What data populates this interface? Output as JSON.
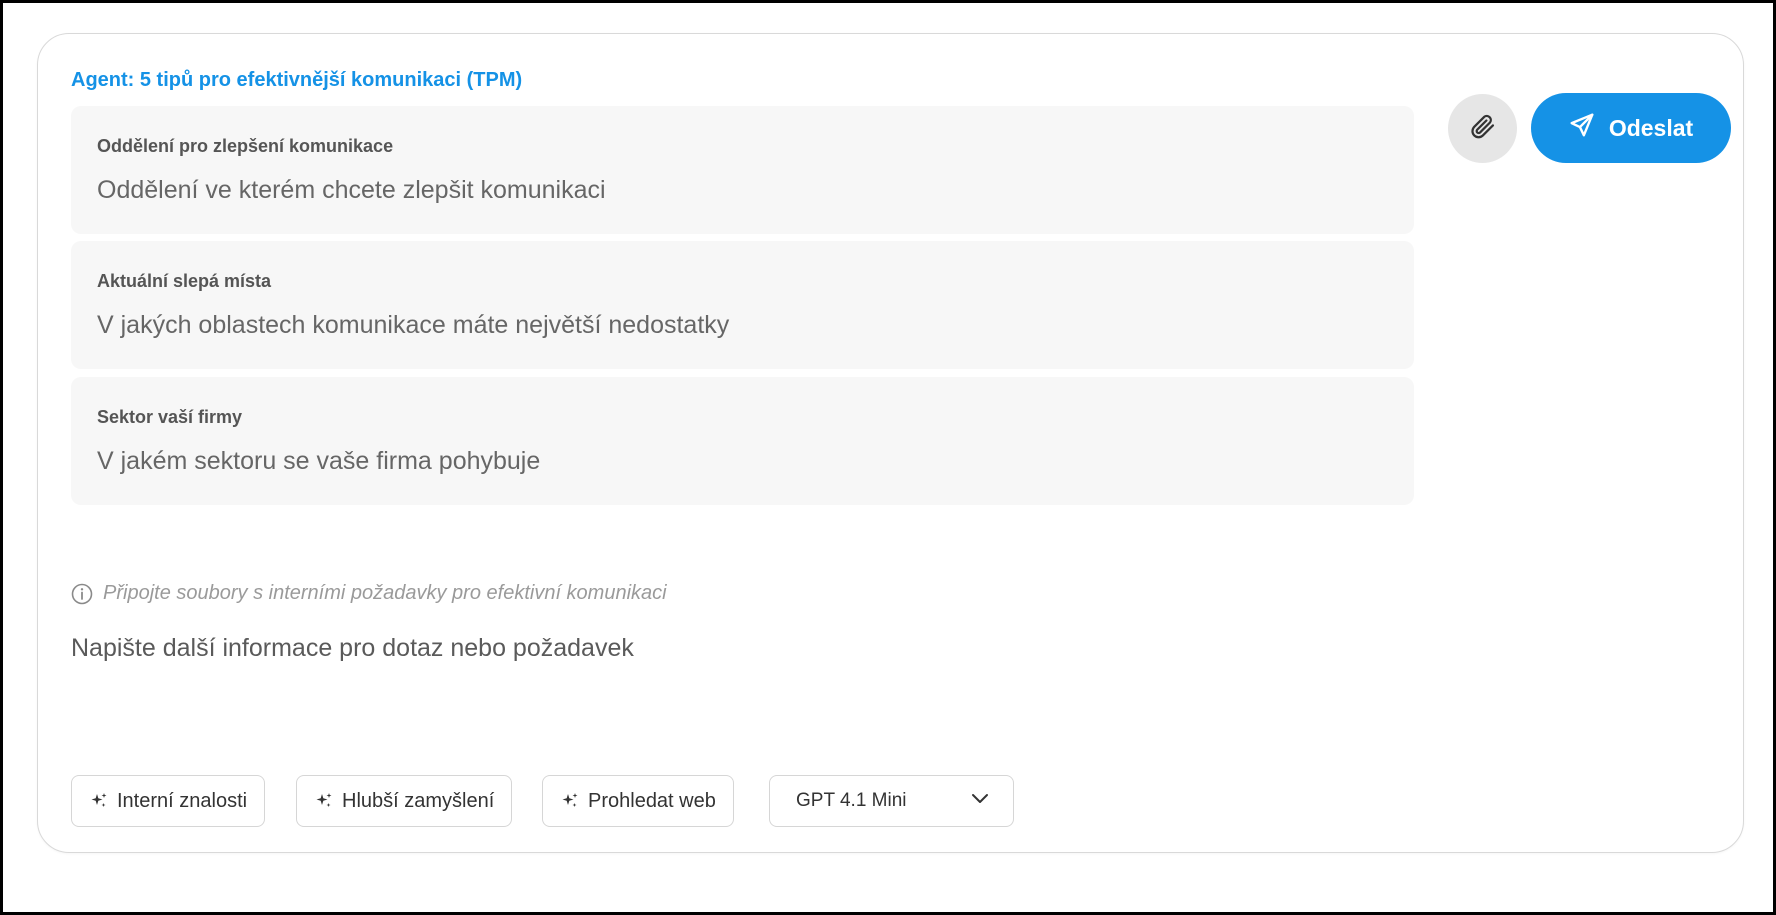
{
  "agent": {
    "title": "Agent: 5 tipů pro efektivnější komunikaci (TPM)"
  },
  "fields": [
    {
      "label": "Oddělení pro zlepšení komunikace",
      "placeholder": "Oddělení ve kterém chcete zlepšit komunikaci",
      "value": ""
    },
    {
      "label": "Aktuální slepá místa",
      "placeholder": "V jakých oblastech komunikace máte největší nedostatky",
      "value": ""
    },
    {
      "label": "Sektor vaší firmy",
      "placeholder": "V jakém sektoru se vaše firma pohybuje",
      "value": ""
    }
  ],
  "hint": {
    "text": "Připojte soubory s interními požadavky pro efektivní komunikaci",
    "icon": "info-icon"
  },
  "extra": {
    "placeholder": "Napište další informace pro dotaz nebo požadavek"
  },
  "actions": {
    "attach_icon": "paperclip-icon",
    "send_label": "Odeslat",
    "send_icon": "send-icon"
  },
  "toolbar": {
    "chips": [
      {
        "label": "Interní znalosti",
        "icon": "sparkle-icon"
      },
      {
        "label": "Hlubší zamyšlení",
        "icon": "sparkle-icon"
      },
      {
        "label": "Prohledat web",
        "icon": "sparkle-icon"
      }
    ],
    "model": {
      "selected": "GPT 4.1 Mini",
      "icon": "chevron-down-icon"
    }
  },
  "colors": {
    "accent": "#1592e6",
    "field_bg": "#f7f7f7",
    "attach_bg": "#e6e6e6",
    "border": "#d6d6d6",
    "hint_text": "#9a9a9a"
  }
}
